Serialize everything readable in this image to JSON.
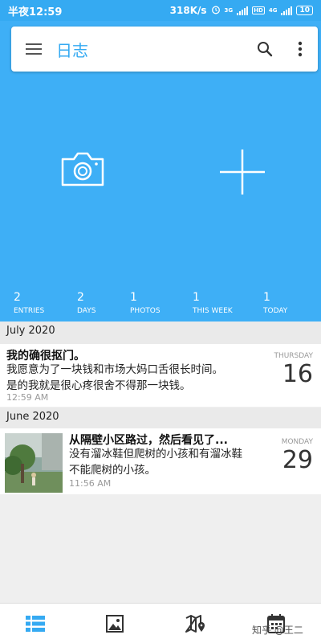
{
  "status_bar": {
    "time": "半夜12:59",
    "speed": "318K/s",
    "net_small_1": "3G",
    "hd": "HD",
    "net_small_2": "4G",
    "battery": "10",
    "icons": [
      "alarm-icon",
      "signal-icon",
      "signal-icon",
      "battery-icon"
    ]
  },
  "app_bar": {
    "title": "日志",
    "icons": [
      "menu-icon",
      "search-icon",
      "more-vert-icon"
    ]
  },
  "hero": {
    "color": "#3eaff6",
    "actions": [
      "camera-icon",
      "plus-icon"
    ],
    "stats": [
      {
        "value": "2",
        "label": "ENTRIES"
      },
      {
        "value": "2",
        "label": "DAYS"
      },
      {
        "value": "1",
        "label": "PHOTOS"
      },
      {
        "value": "1",
        "label": "THIS WEEK"
      },
      {
        "value": "1",
        "label": "TODAY"
      }
    ]
  },
  "sections": [
    {
      "month": "July 2020",
      "entries": [
        {
          "title": "我的确很抠门。",
          "body": [
            "我愿意为了一块钱和市场大妈口舌很长时间。",
            "是的我就是很心疼很舍不得那一块钱。"
          ],
          "time": "12:59 AM",
          "weekday": "THURSDAY",
          "day": "16"
        }
      ]
    },
    {
      "month": "June 2020",
      "entries": [
        {
          "title": "从隔壁小区路过，然后看见了...",
          "body": [
            "没有溜冰鞋但爬树的小孩和有溜冰鞋",
            "不能爬树的小孩。"
          ],
          "time": "11:56 AM",
          "weekday": "MONDAY",
          "day": "29",
          "has_photo": true
        }
      ]
    }
  ],
  "bottom_nav": {
    "accent": "#35aaf2",
    "items": [
      "list-icon",
      "image-icon",
      "map-icon",
      "calendar-icon"
    ]
  },
  "watermark": "知乎 @王二"
}
